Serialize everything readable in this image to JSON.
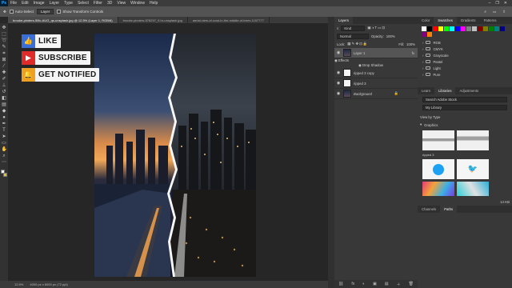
{
  "menubar": {
    "logo": "Ps",
    "items": [
      "File",
      "Edit",
      "Image",
      "Layer",
      "Type",
      "Select",
      "Filter",
      "3D",
      "View",
      "Window",
      "Help"
    ],
    "window_controls": [
      "–",
      "❐",
      "✕"
    ]
  },
  "options": {
    "auto_select_label": "Auto-Select",
    "auto_select_value": "Layer",
    "transform_label": "Show Transform Controls",
    "right_icons": [
      "⌕",
      "▭",
      "⇧"
    ]
  },
  "doc_tabs": [
    "brooke-pinders-5l9c-AUG_qs-unsplash.jpg @ 12.5% (Layer 1, RGB/8)",
    "brooke-pinders-578297_9.hr-unsplash.jpg",
    "aerial-view-of-road-in-the-middle-of-trees-1157777"
  ],
  "social": {
    "like": "LIKE",
    "subscribe": "SUBSCRIBE",
    "notified": "GET NOTIFIED"
  },
  "status": {
    "zoom": "12.5%",
    "dims": "4000 px x 6000 px (72 ppi)"
  },
  "layers_panel": {
    "tab": "Layers",
    "filter_label": "Kind",
    "blend_mode": "Normal",
    "opacity_label": "Opacity:",
    "opacity_value": "100%",
    "lock_label": "Lock:",
    "fill_label": "Fill:",
    "fill_value": "100%",
    "layers": [
      {
        "name": "Layer 1",
        "fx": "fx",
        "selected": true,
        "dark": true
      },
      {
        "name": "ripped 3 copy",
        "fx": "",
        "selected": false,
        "dark": false
      },
      {
        "name": "ripped 3",
        "fx": "",
        "selected": false,
        "dark": false
      },
      {
        "name": "Background",
        "fx": "",
        "selected": false,
        "dark": true
      }
    ],
    "effects_label": "Effects",
    "drop_shadow_label": "Drop Shadow",
    "footer_icons": [
      "⛓",
      "fx",
      "◐",
      "▣",
      "▤",
      "＋",
      "🗑"
    ]
  },
  "swatches_panel": {
    "tabs": [
      "Color",
      "Swatches",
      "Gradients",
      "Patterns"
    ],
    "active_tab": "Swatches",
    "colors": [
      "#ffffff",
      "#000000",
      "#ff0000",
      "#ffff00",
      "#00ff00",
      "#00ffff",
      "#0000ff",
      "#ff00ff",
      "#808080",
      "#c0c0c0",
      "#800000",
      "#808000",
      "#008000",
      "#008080",
      "#000080",
      "#800080",
      "#ff8000"
    ],
    "folders": [
      "RGB",
      "CMYK",
      "Grayscale",
      "Pastel",
      "Light",
      "Pure"
    ]
  },
  "libraries_panel": {
    "tabs": [
      "Learn",
      "Libraries",
      "Adjustments"
    ],
    "active_tab": "Libraries",
    "search_placeholder": "Search Adobe Stock",
    "library_name": "My Library",
    "view_label": "View by Type",
    "graphics_label": "Graphics",
    "graphic_captions": [
      "ripped 3",
      ""
    ],
    "size_label": "14 KB"
  },
  "bottom_tabs": [
    "Channels",
    "Paths"
  ]
}
